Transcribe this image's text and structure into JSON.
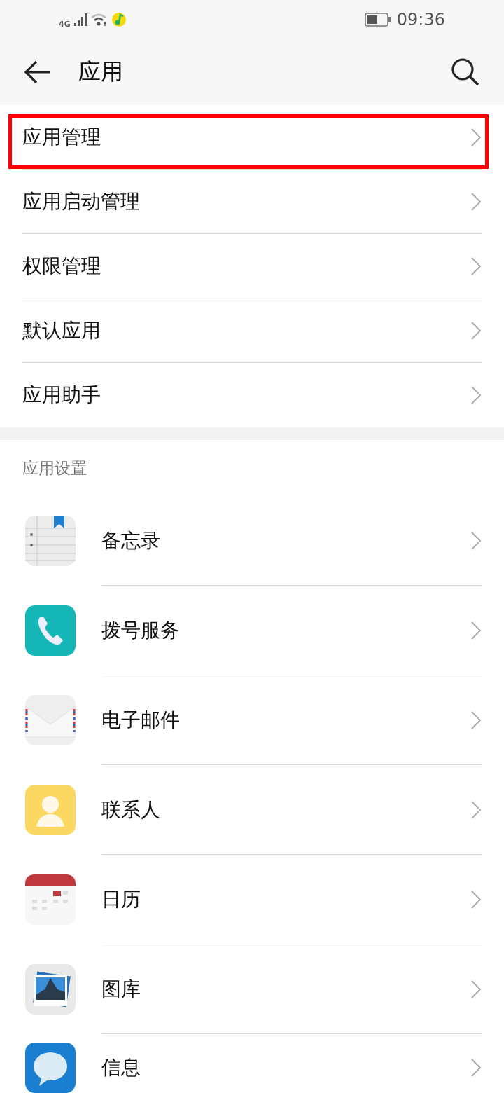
{
  "status_bar": {
    "network": "4G",
    "time": "09:36"
  },
  "header": {
    "title": "应用"
  },
  "menu_items": [
    {
      "label": "应用管理",
      "highlighted": true
    },
    {
      "label": "应用启动管理",
      "highlighted": false
    },
    {
      "label": "权限管理",
      "highlighted": false
    },
    {
      "label": "默认应用",
      "highlighted": false
    },
    {
      "label": "应用助手",
      "highlighted": false
    }
  ],
  "app_settings": {
    "title": "应用设置",
    "apps": [
      {
        "label": "备忘录",
        "kind": "notes"
      },
      {
        "label": "拨号服务",
        "kind": "phone"
      },
      {
        "label": "电子邮件",
        "kind": "mail"
      },
      {
        "label": "联系人",
        "kind": "contacts"
      },
      {
        "label": "日历",
        "kind": "calendar"
      },
      {
        "label": "图库",
        "kind": "gallery"
      },
      {
        "label": "信息",
        "kind": "messages"
      }
    ]
  }
}
